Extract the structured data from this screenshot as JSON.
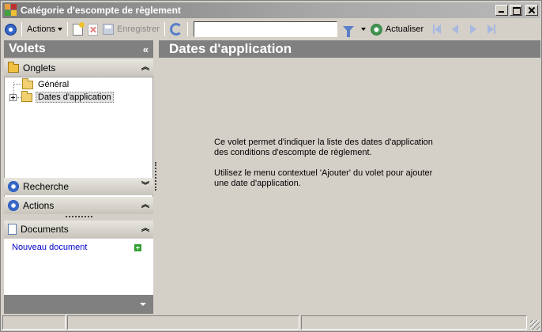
{
  "window": {
    "title": "Catégorie d'escompte de règlement"
  },
  "toolbar": {
    "actions_label": "Actions",
    "save_label": "Enregistrer",
    "search_value": "",
    "refresh_label": "Actualiser"
  },
  "left_panel": {
    "title": "Volets",
    "collapse_glyph": "«",
    "sections": {
      "onglets": {
        "label": "Onglets",
        "chevron": "︽"
      },
      "recherche": {
        "label": "Recherche",
        "chevron": "︾"
      },
      "actions": {
        "label": "Actions",
        "chevron": "︽"
      },
      "documents": {
        "label": "Documents",
        "chevron": "︽"
      }
    },
    "tree": [
      {
        "label": "Général",
        "expandable": false
      },
      {
        "label": "Dates d'application",
        "expandable": true,
        "selected": true
      }
    ],
    "documents": {
      "new_document_link": "Nouveau document"
    }
  },
  "main": {
    "title": "Dates d'application",
    "description_line1": "Ce volet permet d'indiquer la liste des dates d'application des conditions d'escompte de règlement.",
    "description_line2": "Utilisez le menu contextuel 'Ajouter' du volet pour ajouter une date d'application."
  },
  "colors": {
    "panel_header": "#808080",
    "window_bg": "#d4d0c8",
    "link": "#0000cc",
    "accent_blue": "#2150b0"
  }
}
